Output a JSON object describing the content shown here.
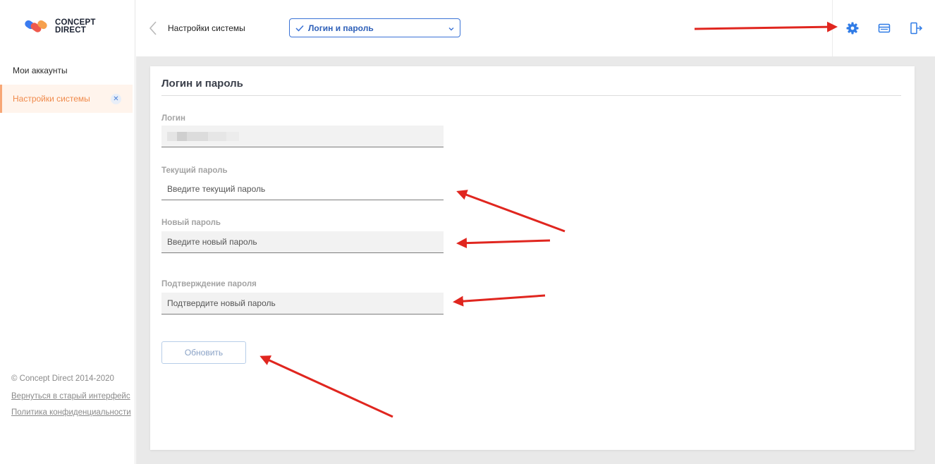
{
  "sidebar": {
    "logo": {
      "line1": "CONCEPT",
      "line2": "DIRECT"
    },
    "items": [
      {
        "label": "Мои аккаунты"
      },
      {
        "label": "Настройки системы",
        "close": "✕"
      }
    ],
    "footer": {
      "copyright": "© Concept Direct 2014-2020",
      "old_interface_link": "Вернуться в старый интерфейс",
      "privacy_link": "Политика конфиденциальности"
    }
  },
  "header": {
    "title": "Настройки системы",
    "select": {
      "value": "Логин и пароль"
    },
    "icons": [
      "gear-icon",
      "wallet-icon",
      "logout-icon"
    ]
  },
  "card": {
    "title": "Логин и пароль",
    "login": {
      "label": "Логин"
    },
    "current_password": {
      "label": "Текущий пароль",
      "placeholder": "Введите текущий пароль"
    },
    "new_password": {
      "label": "Новый пароль",
      "placeholder": "Введите новый пароль"
    },
    "confirm_password": {
      "label": "Подтверждение пароля",
      "placeholder": "Подтвердите новый пароль"
    },
    "update_button": "Обновить"
  },
  "colors": {
    "accent_blue": "#3b73d6",
    "active_nav_bg": "#fff4ec",
    "active_nav_text": "#f08a4b",
    "annotation_red": "#e0261f"
  }
}
